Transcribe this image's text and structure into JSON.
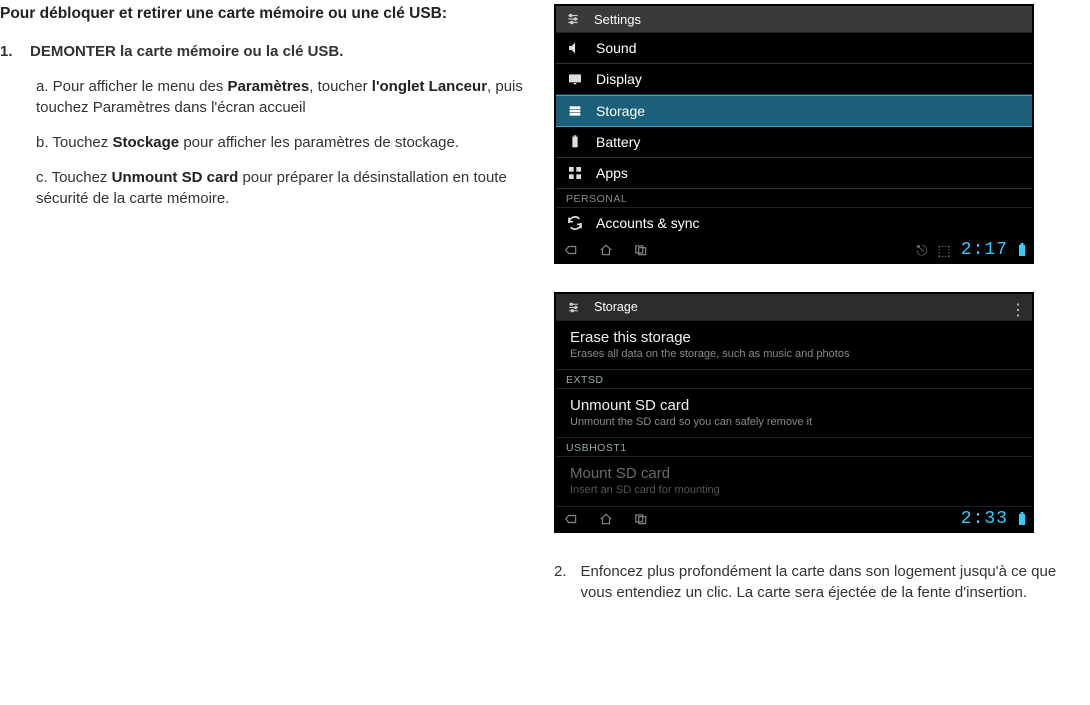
{
  "doc": {
    "heading": "Pour débloquer et retirer une carte mémoire ou une clé USB:",
    "step1_num": "1.",
    "step1_text": "DEMONTER la carte mémoire ou la clé USB.",
    "sub_a_pre": "a. Pour afficher le menu des ",
    "sub_a_b1": "Paramètres",
    "sub_a_mid": ", toucher ",
    "sub_a_b2": "l'onglet Lanceur",
    "sub_a_post": ", puis touchez Paramètres dans l'écran accueil",
    "sub_b_pre": "b. Touchez ",
    "sub_b_b1": "Stockage",
    "sub_b_post": " pour afficher les paramètres de stockage.",
    "sub_c_pre": "c. Touchez ",
    "sub_c_b1": "Unmount SD card",
    "sub_c_post": " pour préparer la désinstallation en toute sécurité de la carte mémoire.",
    "step2_num": "2.",
    "step2_text": "Enfoncez plus profondément la carte dans son logement jusqu'à ce que vous entendiez un clic. La carte sera éjectée de la fente d'insertion."
  },
  "shot1": {
    "title": "Settings",
    "items": {
      "sound": "Sound",
      "display": "Display",
      "storage": "Storage",
      "battery": "Battery",
      "apps": "Apps"
    },
    "section": "PERSONAL",
    "accounts": "Accounts & sync",
    "time": "2:17"
  },
  "shot2": {
    "title": "Storage",
    "erase_title": "Erase this storage",
    "erase_sub": "Erases all data on the storage, such as music and photos",
    "sec1": "EXTSD",
    "unmount_title": "Unmount SD card",
    "unmount_sub": "Unmount the SD card so you can safely remove it",
    "sec2": "USBHOST1",
    "mount_title": "Mount SD card",
    "mount_sub": "Insert an SD card for mounting",
    "time": "2:33"
  }
}
